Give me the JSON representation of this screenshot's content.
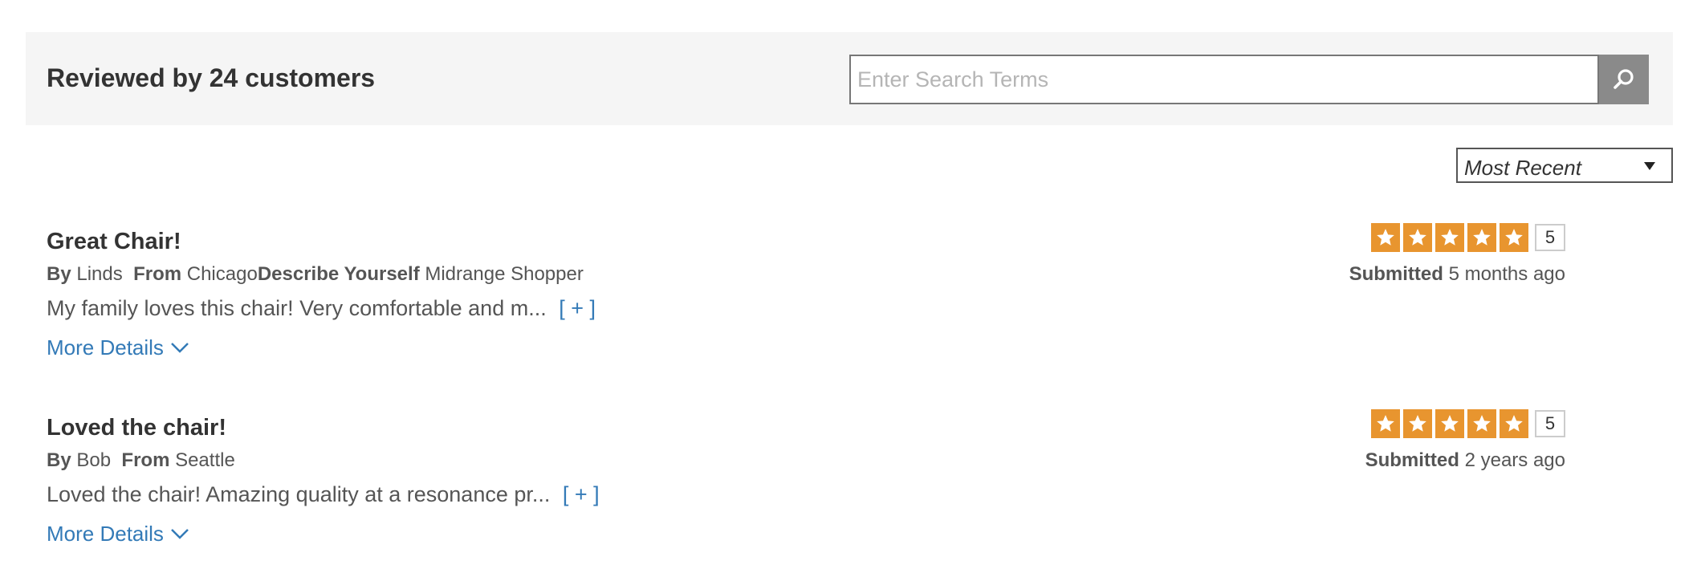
{
  "header": {
    "title": "Reviewed by 24 customers",
    "search_placeholder": "Enter Search Terms",
    "search_value": ""
  },
  "sort": {
    "selected": "Most Recent"
  },
  "labels": {
    "by": "By",
    "from": "From",
    "describe_yourself": "Describe Yourself",
    "submitted": "Submitted",
    "expand": "[ + ]",
    "more_details": "More Details"
  },
  "reviews": [
    {
      "title": "Great Chair!",
      "author": "Linds",
      "location": "Chicago",
      "describe_yourself": "Midrange Shopper",
      "excerpt": "My family loves this chair! Very comfortable and m...",
      "rating": 5,
      "rating_text": "5",
      "submitted": "5 months ago"
    },
    {
      "title": "Loved the chair!",
      "author": "Bob",
      "location": "Seattle",
      "excerpt": "Loved the chair! Amazing quality at a resonance pr...",
      "rating": 5,
      "rating_text": "5",
      "submitted": "2 years ago"
    }
  ],
  "colors": {
    "header_bg": "#f5f5f5",
    "star": "#e8952f",
    "link": "#337ab7",
    "search_button": "#8a8a8a"
  },
  "icons": {
    "search": "search-icon",
    "star": "star-icon",
    "chevron": "chevron-down-icon",
    "caret": "caret-down-icon"
  }
}
